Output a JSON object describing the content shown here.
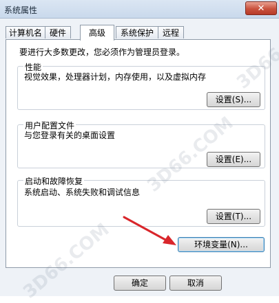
{
  "window": {
    "title": "系统属性",
    "close_label": "✕"
  },
  "tabs": [
    {
      "label": "计算机名",
      "active": false
    },
    {
      "label": "硬件",
      "active": false
    },
    {
      "label": "高级",
      "active": true
    },
    {
      "label": "系统保护",
      "active": false
    },
    {
      "label": "远程",
      "active": false
    }
  ],
  "admin_note": "要进行大多数更改，您必须作为管理员登录。",
  "groups": {
    "performance": {
      "title": "性能",
      "desc": "视觉效果，处理器计划，内存使用，以及虚拟内存",
      "button": "设置(S)..."
    },
    "user_profiles": {
      "title": "用户配置文件",
      "desc": "与您登录有关的桌面设置",
      "button": "设置(E)..."
    },
    "startup_recovery": {
      "title": "启动和故障恢复",
      "desc": "系统启动、系统失败和调试信息",
      "button": "设置(T)..."
    }
  },
  "env_button": "环境变量(N)...",
  "footer": {
    "ok": "确定",
    "cancel": "取消"
  },
  "watermark": "3D66.COM",
  "colors": {
    "arrow": "#d9262b",
    "close": "#c9523e"
  }
}
